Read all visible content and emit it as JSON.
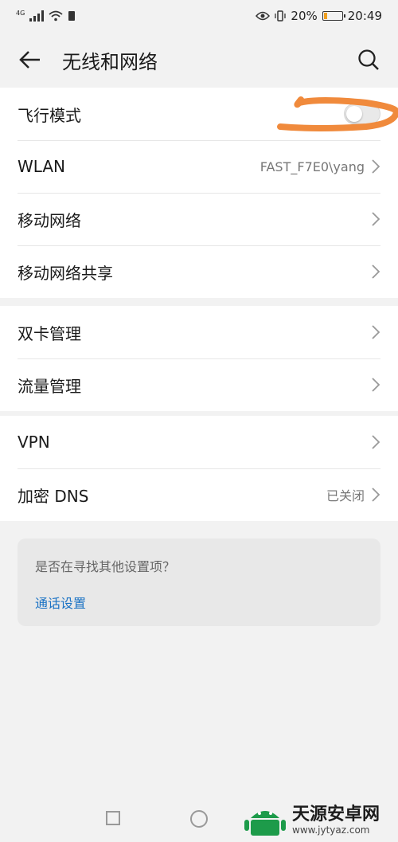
{
  "status_bar": {
    "network_type": "4G",
    "battery_percent": "20%",
    "battery_level": 0.2,
    "time": "20:49"
  },
  "header": {
    "title": "无线和网络"
  },
  "groups": [
    {
      "rows": [
        {
          "label": "飞行模式",
          "toggle_on": false
        },
        {
          "label": "WLAN",
          "value": "FAST_F7E0\\yang"
        },
        {
          "label": "移动网络"
        },
        {
          "label": "移动网络共享"
        }
      ]
    },
    {
      "rows": [
        {
          "label": "双卡管理"
        },
        {
          "label": "流量管理"
        }
      ]
    },
    {
      "rows": [
        {
          "label": "VPN"
        },
        {
          "label": "加密 DNS",
          "value": "已关闭"
        }
      ]
    }
  ],
  "suggestion": {
    "question": "是否在寻找其他设置项？",
    "link": "通话设置"
  },
  "watermark": {
    "title": "天源安卓网",
    "url": "www.jytyaz.com"
  },
  "colors": {
    "accent": "#1a72c4",
    "scribble": "#f08a3c",
    "battery": "#f0a020"
  }
}
